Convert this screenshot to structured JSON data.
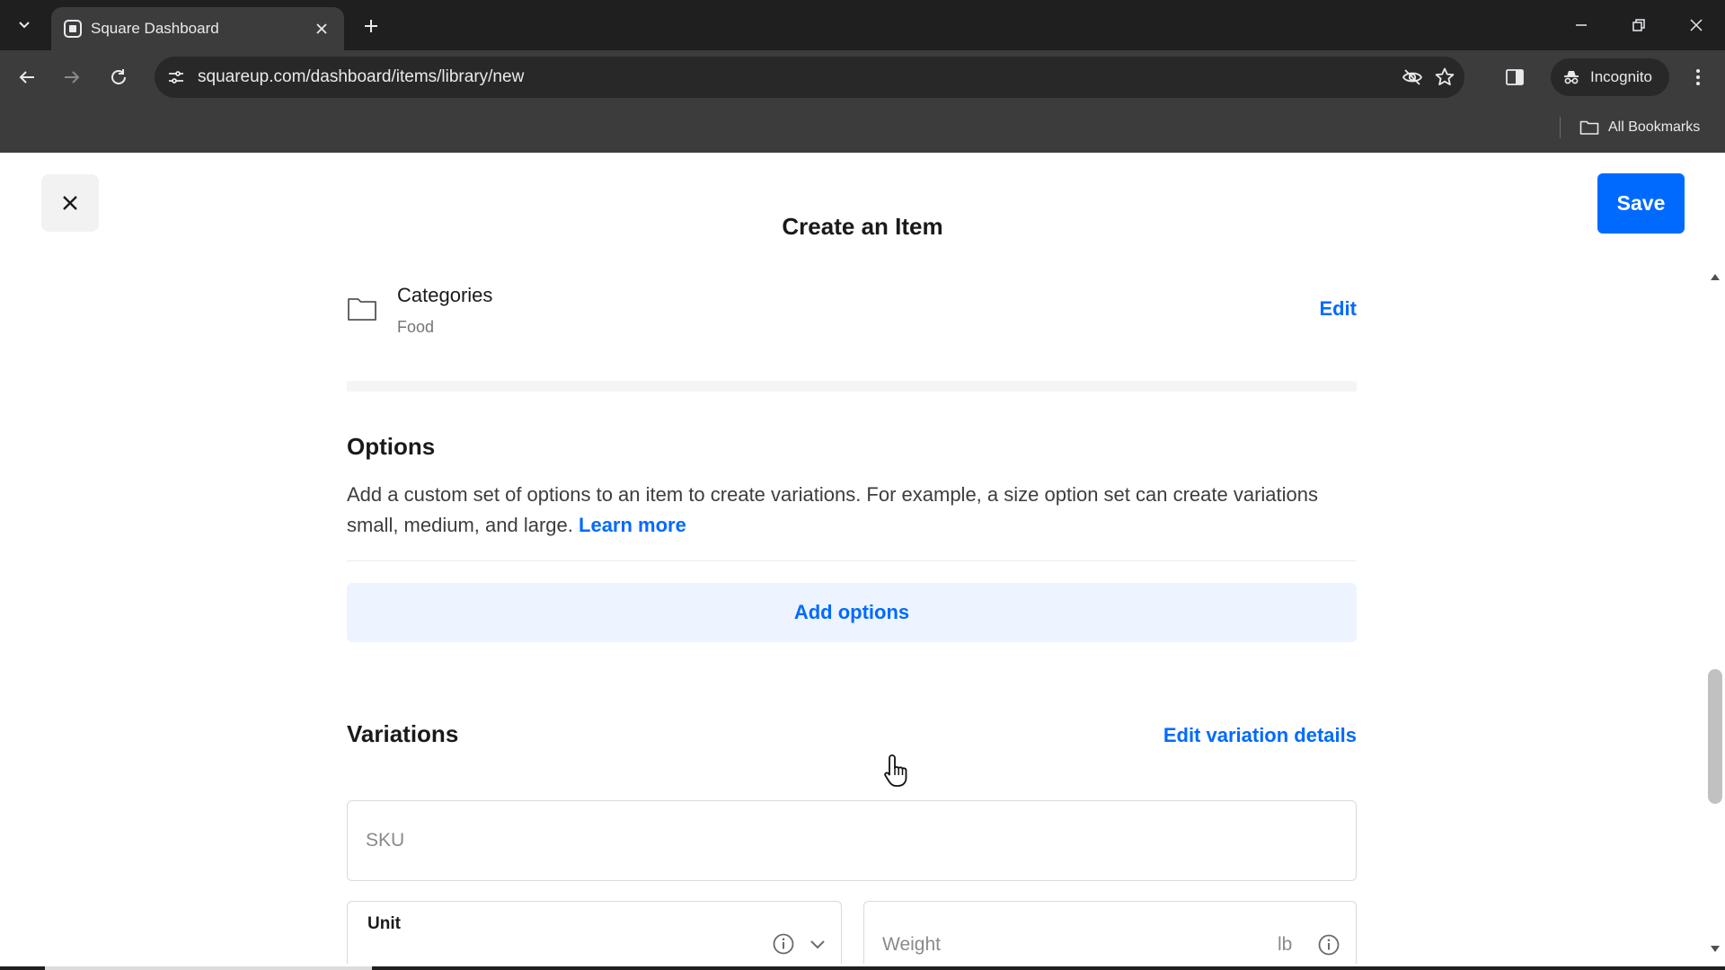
{
  "browser": {
    "tab_title": "Square Dashboard",
    "url": "squareup.com/dashboard/items/library/new",
    "incognito_label": "Incognito",
    "bookmarks_label": "All Bookmarks"
  },
  "page": {
    "title": "Create an Item",
    "save_label": "Save"
  },
  "categories": {
    "title": "Categories",
    "value": "Food",
    "edit_label": "Edit"
  },
  "options": {
    "title": "Options",
    "description": "Add a custom set of options to an item to create variations. For example, a size option set can create variations small, medium, and large.",
    "learn_more": "Learn more",
    "add_label": "Add options"
  },
  "variations": {
    "title": "Variations",
    "edit_label": "Edit variation details",
    "sku_placeholder": "SKU",
    "unit_label": "Unit",
    "weight_placeholder": "Weight",
    "weight_unit": "lb"
  },
  "colors": {
    "accent": "#006aff",
    "add_options_bg": "#edf4ff",
    "chrome_dark": "#1f1f1f",
    "chrome_toolbar": "#3c3c3c"
  },
  "icons": {
    "tab_search": "chevron-down-icon",
    "favicon": "square-logo-icon",
    "close": "close-icon",
    "new_tab": "plus-icon",
    "back": "arrow-left-icon",
    "forward": "arrow-right-icon",
    "reload": "reload-icon",
    "site_info": "tune-icon",
    "tracking": "eye-off-icon",
    "bookmark": "star-icon",
    "side_panel": "side-panel-icon",
    "incognito": "incognito-icon",
    "menu": "more-vertical-icon",
    "folder": "folder-icon",
    "info": "info-icon"
  }
}
